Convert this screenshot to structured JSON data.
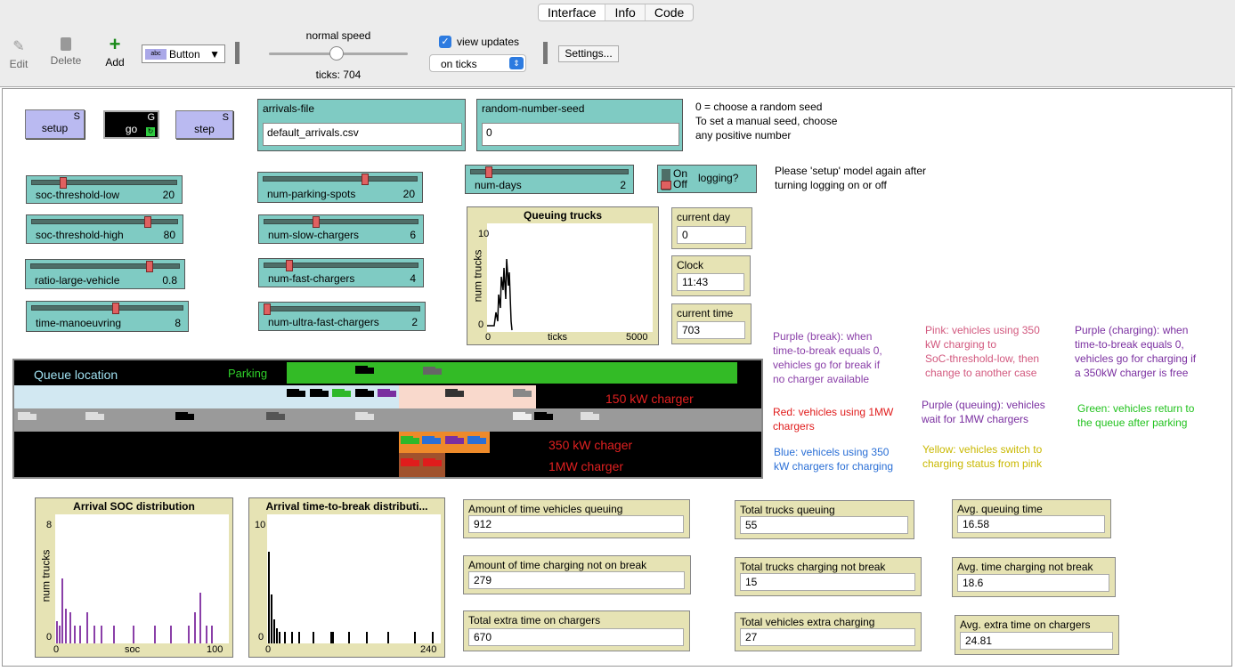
{
  "tabs": [
    "Interface",
    "Info",
    "Code"
  ],
  "toolbar": {
    "edit": "Edit",
    "delete": "Delete",
    "add": "Add",
    "widget_select": "Button",
    "speed_label": "normal speed",
    "ticks": "ticks: 704",
    "view_updates": "view updates",
    "update_mode": "on ticks",
    "settings": "Settings..."
  },
  "buttons": {
    "setup": "setup",
    "setup_key": "S",
    "go": "go",
    "go_key": "G",
    "step": "step",
    "step_key": "S"
  },
  "inputs": {
    "arrivals_label": "arrivals-file",
    "arrivals_value": "default_arrivals.csv",
    "seed_label": "random-number-seed",
    "seed_value": "0"
  },
  "seed_note": [
    "0 = choose a random seed",
    "To set a manual seed, choose",
    "any positive number"
  ],
  "sliders": [
    {
      "name": "soc-threshold-low",
      "value": "20",
      "fraction": 0.2
    },
    {
      "name": "soc-threshold-high",
      "value": "80",
      "fraction": 0.8
    },
    {
      "name": "ratio-large-vehicle",
      "value": "0.8",
      "fraction": 0.8
    },
    {
      "name": "time-manoeuvring",
      "value": "8",
      "fraction": 0.55
    },
    {
      "name": "num-parking-spots",
      "value": "20",
      "fraction": 0.66
    },
    {
      "name": "num-slow-chargers",
      "value": "6",
      "fraction": 0.33
    },
    {
      "name": "num-fast-chargers",
      "value": "4",
      "fraction": 0.15
    },
    {
      "name": "num-ultra-fast-chargers",
      "value": "2",
      "fraction": 0.0
    },
    {
      "name": "num-days",
      "value": "2",
      "fraction": 0.1
    }
  ],
  "switch": {
    "on": "On",
    "off": "Off",
    "label": "logging?"
  },
  "logging_note": [
    "Please 'setup' model again after",
    "turning logging on or off"
  ],
  "queuing_plot": {
    "title": "Queuing trucks",
    "ylabel": "num trucks",
    "xlabel": "ticks",
    "ymin": "0",
    "ymax": "10",
    "xmin": "0",
    "xmax": "5000"
  },
  "monitors": {
    "current_day_label": "current day",
    "current_day": "0",
    "clock_label": "Clock",
    "clock": "11:43",
    "current_time_label": "current time",
    "current_time": "703"
  },
  "world": {
    "queue_location": "Queue location",
    "parking": "Parking",
    "c150": "150 kW charger",
    "c350": "350 kW chager",
    "c1mw": "1MW charger"
  },
  "legend": [
    {
      "text": [
        "Purple (break): when",
        "time-to-break equals 0,",
        "vehicles go for break if",
        "no charger available"
      ],
      "color": "#8a3fa8"
    },
    {
      "text": [
        "Pink: vehicles using 350",
        "kW charging to",
        "SoC-threshold-low, then",
        "change to another case"
      ],
      "color": "#d2587e"
    },
    {
      "text": [
        "Purple (charging): when",
        "time-to-break equals 0,",
        "vehicles go for charging if",
        "a 350kW charger is free"
      ],
      "color": "#7a2fa0"
    },
    {
      "text": [
        "Red: vehicles using 1MW",
        "chargers"
      ],
      "color": "#e01c1c"
    },
    {
      "text": [
        "Purple (queuing): vehicles",
        "wait for 1MW chargers"
      ],
      "color": "#7a2fa0"
    },
    {
      "text": [
        "Green: vehicles return to",
        "the queue after parking"
      ],
      "color": "#22c21e"
    },
    {
      "text": [
        "Blue: vehicels using 350",
        "kW chargers for charging"
      ],
      "color": "#2a6fd6"
    },
    {
      "text": [
        "Yellow: vehicles switch to",
        "charging status from pink"
      ],
      "color": "#c9b800"
    }
  ],
  "soc_plot": {
    "title": "Arrival SOC distribution",
    "ylabel": "num trucks",
    "xlabel": "soc",
    "ymin": "0",
    "ymax": "8",
    "xmin": "0",
    "xmax": "100"
  },
  "ttb_plot": {
    "title": "Arrival time-to-break distributi...",
    "ymin": "0",
    "ymax": "10",
    "xmin": "0",
    "xmax": "240"
  },
  "stats": [
    {
      "label": "Amount of time vehicles queuing",
      "value": "912"
    },
    {
      "label": "Amount of time charging not on break",
      "value": "279"
    },
    {
      "label": "Total extra time on chargers",
      "value": "670"
    },
    {
      "label": "Total trucks queuing",
      "value": "55"
    },
    {
      "label": "Total trucks charging not break",
      "value": "15"
    },
    {
      "label": "Total vehicles extra charging",
      "value": "27"
    },
    {
      "label": "Avg. queuing time",
      "value": "16.58"
    },
    {
      "label": "Avg. time charging not break",
      "value": "18.6"
    },
    {
      "label": "Avg. extra time on chargers",
      "value": "24.81"
    }
  ]
}
